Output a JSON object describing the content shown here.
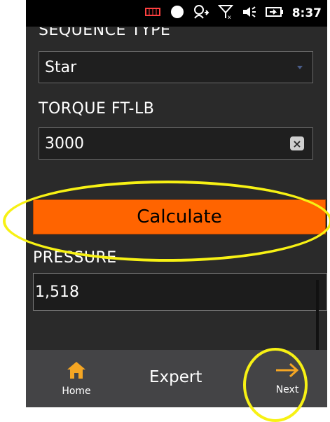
{
  "status_bar": {
    "time": "8:37",
    "icons": [
      "battery-low-icon",
      "circle-icon",
      "sync-icon",
      "signal-off-icon",
      "volume-icon",
      "battery-charge-icon"
    ]
  },
  "form": {
    "sequence_type_label": "SEQUENCE TYPE",
    "sequence_type_value": "Star",
    "torque_label": "TORQUE FT-LB",
    "torque_value": "3000",
    "calculate_label": "Calculate",
    "pressure_label": "PRESSURE",
    "pressure_value": "1,518"
  },
  "bottom_nav": {
    "home_label": "Home",
    "expert_label": "Expert",
    "next_label": "Next"
  },
  "colors": {
    "accent_orange": "#ff6400",
    "highlight_yellow": "#f7f114",
    "background": "#2a2a2a"
  }
}
